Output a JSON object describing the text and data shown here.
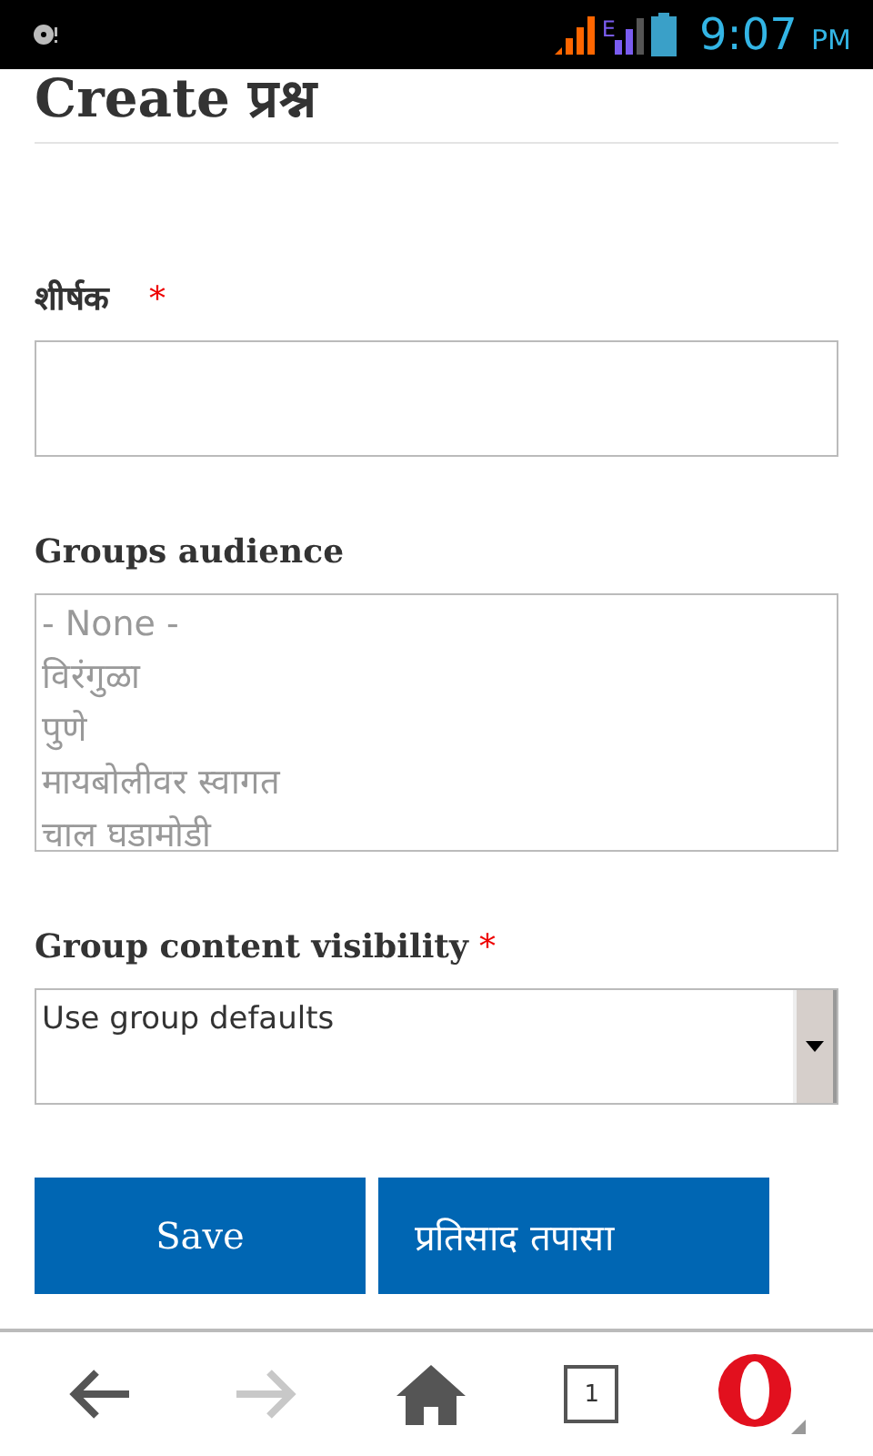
{
  "status_bar": {
    "time": "9:07",
    "ampm": "PM",
    "network": "E"
  },
  "title": "Create प्रश्न",
  "fields": [
    {
      "kind": "text",
      "label": "शीर्षक",
      "required_mark": "*"
    },
    {
      "kind": "list",
      "label": "Groups audience",
      "options": [
        "- None -",
        "विरंगुळा",
        "पुणे",
        "मायबोलीवर स्वागत",
        "चाल घडामोडी"
      ]
    },
    {
      "kind": "select",
      "label": "Group content visibility",
      "required_mark": "*",
      "value": "Use group defaults"
    }
  ],
  "buttons": [
    "Save",
    "प्रतिसाद तपासा"
  ],
  "nav": [
    {
      "kind": "back",
      "disabled": false
    },
    {
      "kind": "forward",
      "disabled": true
    },
    {
      "kind": "home",
      "disabled": false
    },
    {
      "kind": "tabs",
      "count": "1",
      "disabled": false
    },
    {
      "kind": "menu",
      "disabled": false
    }
  ]
}
